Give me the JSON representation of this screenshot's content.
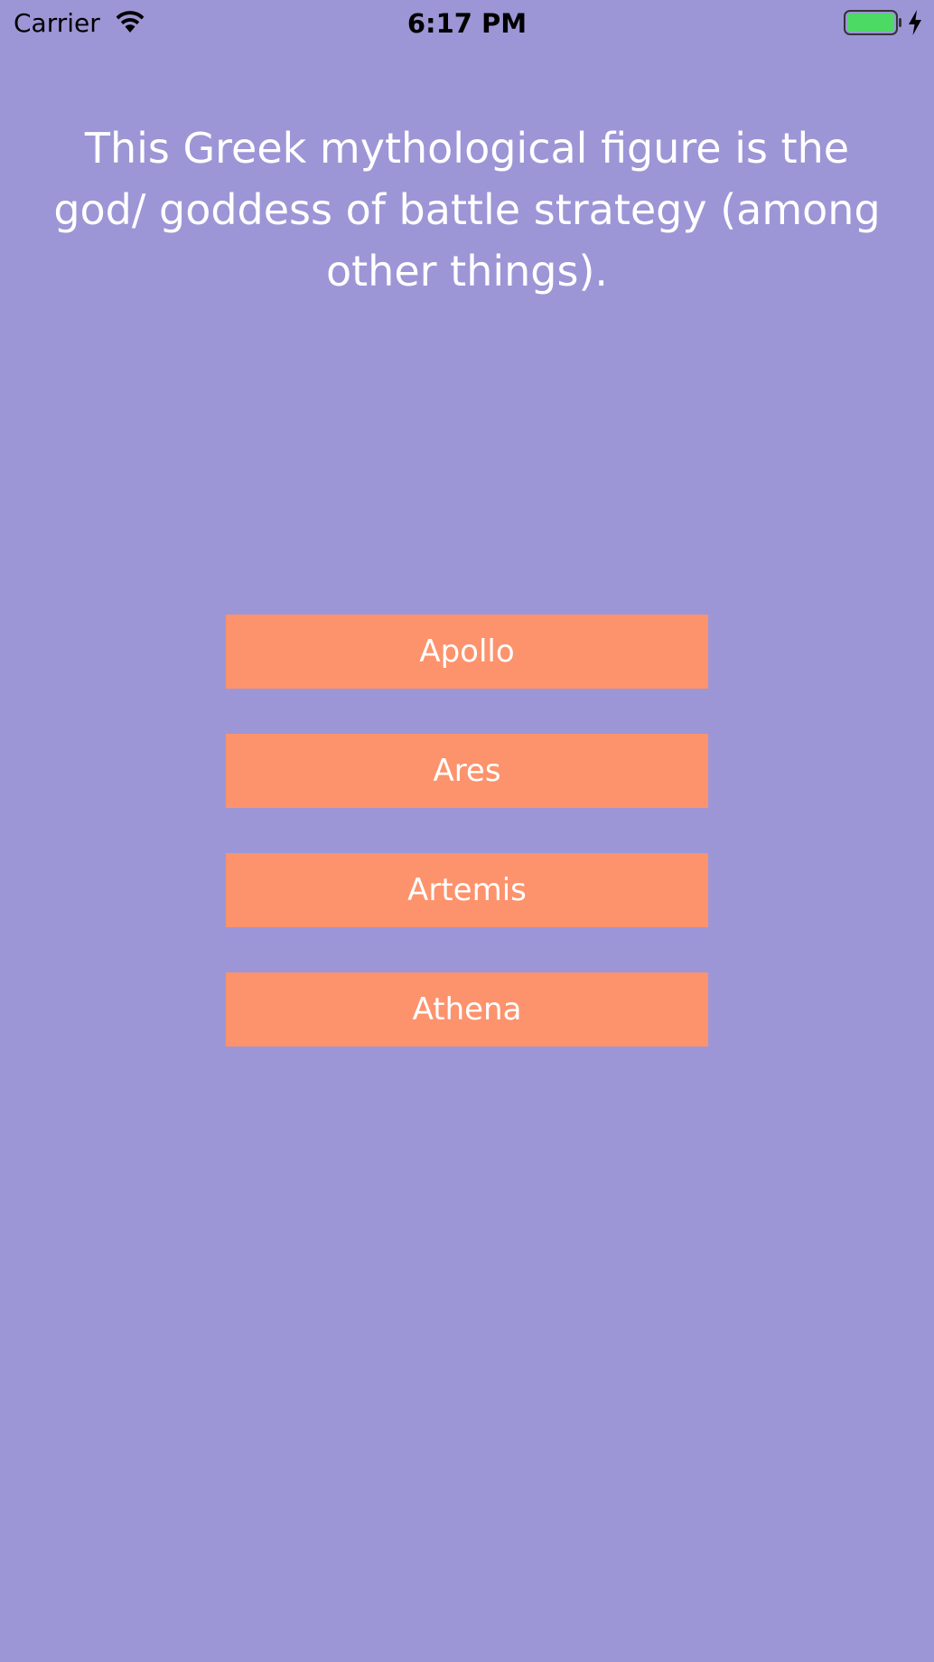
{
  "status_bar": {
    "carrier": "Carrier",
    "time": "6:17 PM",
    "icons": [
      "wifi-icon",
      "battery-icon",
      "charging-bolt-icon"
    ],
    "battery_level": 1.0
  },
  "question": {
    "text": "This Greek mythological figure is the god/ goddess of battle strategy (among other things)."
  },
  "answers": [
    {
      "label": "Apollo"
    },
    {
      "label": "Ares"
    },
    {
      "label": "Artemis"
    },
    {
      "label": "Athena"
    }
  ],
  "colors": {
    "background": "#9c96d6",
    "button": "#fc936d",
    "text": "#ffffff",
    "battery_fill": "#4cd964"
  }
}
